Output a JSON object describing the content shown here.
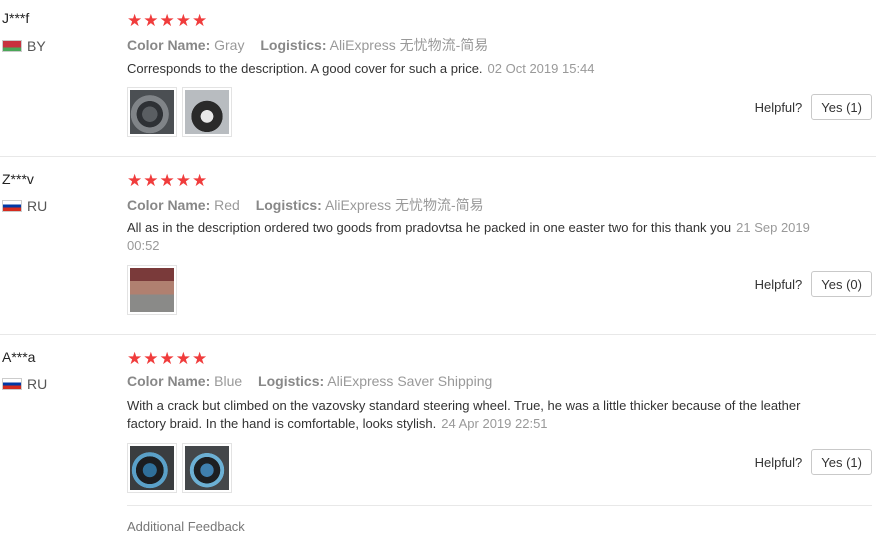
{
  "reviews": [
    {
      "user": "J***f",
      "country": "BY",
      "stars": "★★★★★",
      "color_label": "Color Name:",
      "color_value": "Gray",
      "logistics_label": "Logistics:",
      "logistics_value": "AliExpress 无忧物流-简易",
      "text": "Corresponds to the description. A good cover for such a price.",
      "date": "02 Oct 2019 15:44",
      "helpful_label": "Helpful?",
      "yes_label": "Yes (1)"
    },
    {
      "user": "Z***v",
      "country": "RU",
      "stars": "★★★★★",
      "color_label": "Color Name:",
      "color_value": "Red",
      "logistics_label": "Logistics:",
      "logistics_value": "AliExpress 无忧物流-简易",
      "text": "All as in the description ordered two goods from pradovtsa he packed in one easter two for this thank you",
      "date": "21 Sep 2019 00:52",
      "helpful_label": "Helpful?",
      "yes_label": "Yes (0)"
    },
    {
      "user": "A***a",
      "country": "RU",
      "stars": "★★★★★",
      "color_label": "Color Name:",
      "color_value": "Blue",
      "logistics_label": "Logistics:",
      "logistics_value": "AliExpress Saver Shipping",
      "text": "With a crack but climbed on the vazovsky standard steering wheel. True, he was a little thicker because of the leather factory braid. In the hand is comfortable, looks stylish.",
      "date": "24 Apr 2019 22:51",
      "helpful_label": "Helpful?",
      "yes_label": "Yes (1)"
    }
  ],
  "additional_feedback_label": "Additional Feedback"
}
